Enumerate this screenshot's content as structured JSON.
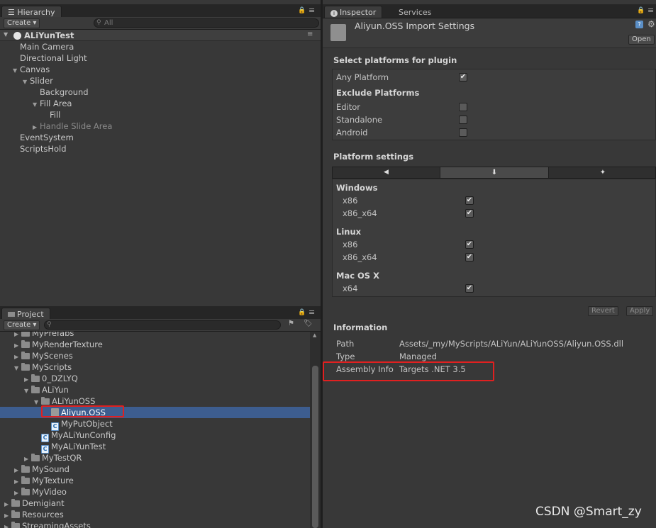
{
  "hierarchy": {
    "tab_label": "Hierarchy",
    "create_label": "Create ▾",
    "search_placeholder": "All",
    "scene_name": "ALiYunTest",
    "items": [
      {
        "label": "Main Camera",
        "depth": 1,
        "arrow": ""
      },
      {
        "label": "Directional Light",
        "depth": 1,
        "arrow": ""
      },
      {
        "label": "Canvas",
        "depth": 1,
        "arrow": "▼"
      },
      {
        "label": "Slider",
        "depth": 2,
        "arrow": "▼"
      },
      {
        "label": "Background",
        "depth": 3,
        "arrow": ""
      },
      {
        "label": "Fill Area",
        "depth": 3,
        "arrow": "▼"
      },
      {
        "label": "Fill",
        "depth": 4,
        "arrow": ""
      },
      {
        "label": "Handle Slide Area",
        "depth": 3,
        "arrow": "▶",
        "dim": true
      },
      {
        "label": "EventSystem",
        "depth": 1,
        "arrow": ""
      },
      {
        "label": "ScriptsHold",
        "depth": 1,
        "arrow": ""
      }
    ]
  },
  "project": {
    "tab_label": "Project",
    "create_label": "Create ▾",
    "items": [
      {
        "label": "MyPrefabs",
        "icon": "folder",
        "arrow": "▶",
        "indent": 20
      },
      {
        "label": "MyRenderTexture",
        "icon": "folder",
        "arrow": "▶",
        "indent": 20
      },
      {
        "label": "MyScenes",
        "icon": "folder",
        "arrow": "▶",
        "indent": 20
      },
      {
        "label": "MyScripts",
        "icon": "folder",
        "arrow": "▼",
        "indent": 20
      },
      {
        "label": "0_DZLYQ",
        "icon": "folder",
        "arrow": "▶",
        "indent": 34
      },
      {
        "label": "ALiYun",
        "icon": "folder",
        "arrow": "▼",
        "indent": 34
      },
      {
        "label": "ALiYunOSS",
        "icon": "folder",
        "arrow": "▼",
        "indent": 48
      },
      {
        "label": "Aliyun.OSS",
        "icon": "dll",
        "arrow": "",
        "indent": 62,
        "selected": true
      },
      {
        "label": "MyPutObject",
        "icon": "cs",
        "arrow": "",
        "indent": 62
      },
      {
        "label": "MyALiYunConfig",
        "icon": "cs",
        "arrow": "",
        "indent": 48
      },
      {
        "label": "MyALiYunTest",
        "icon": "cs",
        "arrow": "",
        "indent": 48
      },
      {
        "label": "MyTestQR",
        "icon": "folder",
        "arrow": "▶",
        "indent": 34
      },
      {
        "label": "MySound",
        "icon": "folder",
        "arrow": "▶",
        "indent": 20
      },
      {
        "label": "MyTexture",
        "icon": "folder",
        "arrow": "▶",
        "indent": 20
      },
      {
        "label": "MyVideo",
        "icon": "folder",
        "arrow": "▶",
        "indent": 20
      },
      {
        "label": "Demigiant",
        "icon": "folder",
        "arrow": "▶",
        "indent": 6
      },
      {
        "label": "Resources",
        "icon": "folder",
        "arrow": "▶",
        "indent": 6
      },
      {
        "label": "StreamingAssets",
        "icon": "folder",
        "arrow": "▶",
        "indent": 6
      }
    ]
  },
  "inspector": {
    "tab_label": "Inspector",
    "services_label": "Services",
    "title": "Aliyun.OSS Import Settings",
    "open_label": "Open",
    "select_platforms_heading": "Select platforms for plugin",
    "any_platform_label": "Any Platform",
    "exclude_heading": "Exclude Platforms",
    "exclude_items": [
      "Editor",
      "Standalone",
      "Android"
    ],
    "platform_settings_heading": "Platform settings",
    "groups": [
      {
        "name": "Windows",
        "items": [
          "x86",
          "x86_x64"
        ]
      },
      {
        "name": "Linux",
        "items": [
          "x86",
          "x86_x64"
        ]
      },
      {
        "name": "Mac OS X",
        "items": [
          "x64"
        ]
      }
    ],
    "revert_label": "Revert",
    "apply_label": "Apply",
    "information_heading": "Information",
    "info_rows": [
      {
        "key": "Path",
        "value": "Assets/_my/MyScripts/ALiYun/ALiYunOSS/Aliyun.OSS.dll"
      },
      {
        "key": "Type",
        "value": "Managed"
      },
      {
        "key": "Assembly Info",
        "value": "Targets .NET 3.5"
      }
    ]
  },
  "watermark": "CSDN @Smart_zy",
  "colors": {
    "selection": "#3d5d8f",
    "highlight_box": "#e02020",
    "panel": "#383838"
  }
}
